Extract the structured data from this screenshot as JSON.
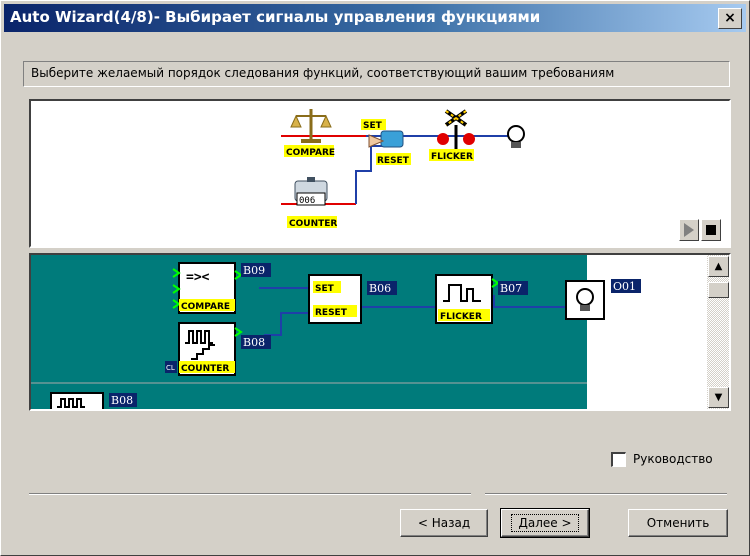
{
  "window": {
    "title": "Auto Wizard(4/8)- Выбирает сигналы управления функциями",
    "close_label": "×"
  },
  "instruction": "Выберите желаемый порядок следования функций, соответствующий вашим требованиям",
  "preview": {
    "compare_label": "COMPARE",
    "counter_label": "COUNTER",
    "counter_digits": "006",
    "set_label": "SET",
    "reset_label": "RESET",
    "flicker_label": "FLICKER",
    "play_icon": "play-icon",
    "stop_icon": "stop-icon"
  },
  "editor": {
    "compare": {
      "symbol": "=><",
      "label": "COMPARE",
      "out": "B09"
    },
    "counter": {
      "label": "COUNTER",
      "out": "B08",
      "cl": "CL"
    },
    "setreset": {
      "set": "SET",
      "reset": "RESET",
      "out": "B06"
    },
    "flicker": {
      "label": "FLICKER",
      "out": "B07"
    },
    "output": {
      "label": "O01"
    },
    "partial": {
      "out": "B08"
    },
    "colors": {
      "canvas": "#007b7b",
      "wire": "#1f3fa8",
      "label_bg": "#0a246a",
      "tag_bg": "#ffff00"
    }
  },
  "checkbox": {
    "label": "Руководство",
    "checked": false
  },
  "buttons": {
    "back": "< Назад",
    "next": "Далее >",
    "cancel": "Отменить"
  }
}
